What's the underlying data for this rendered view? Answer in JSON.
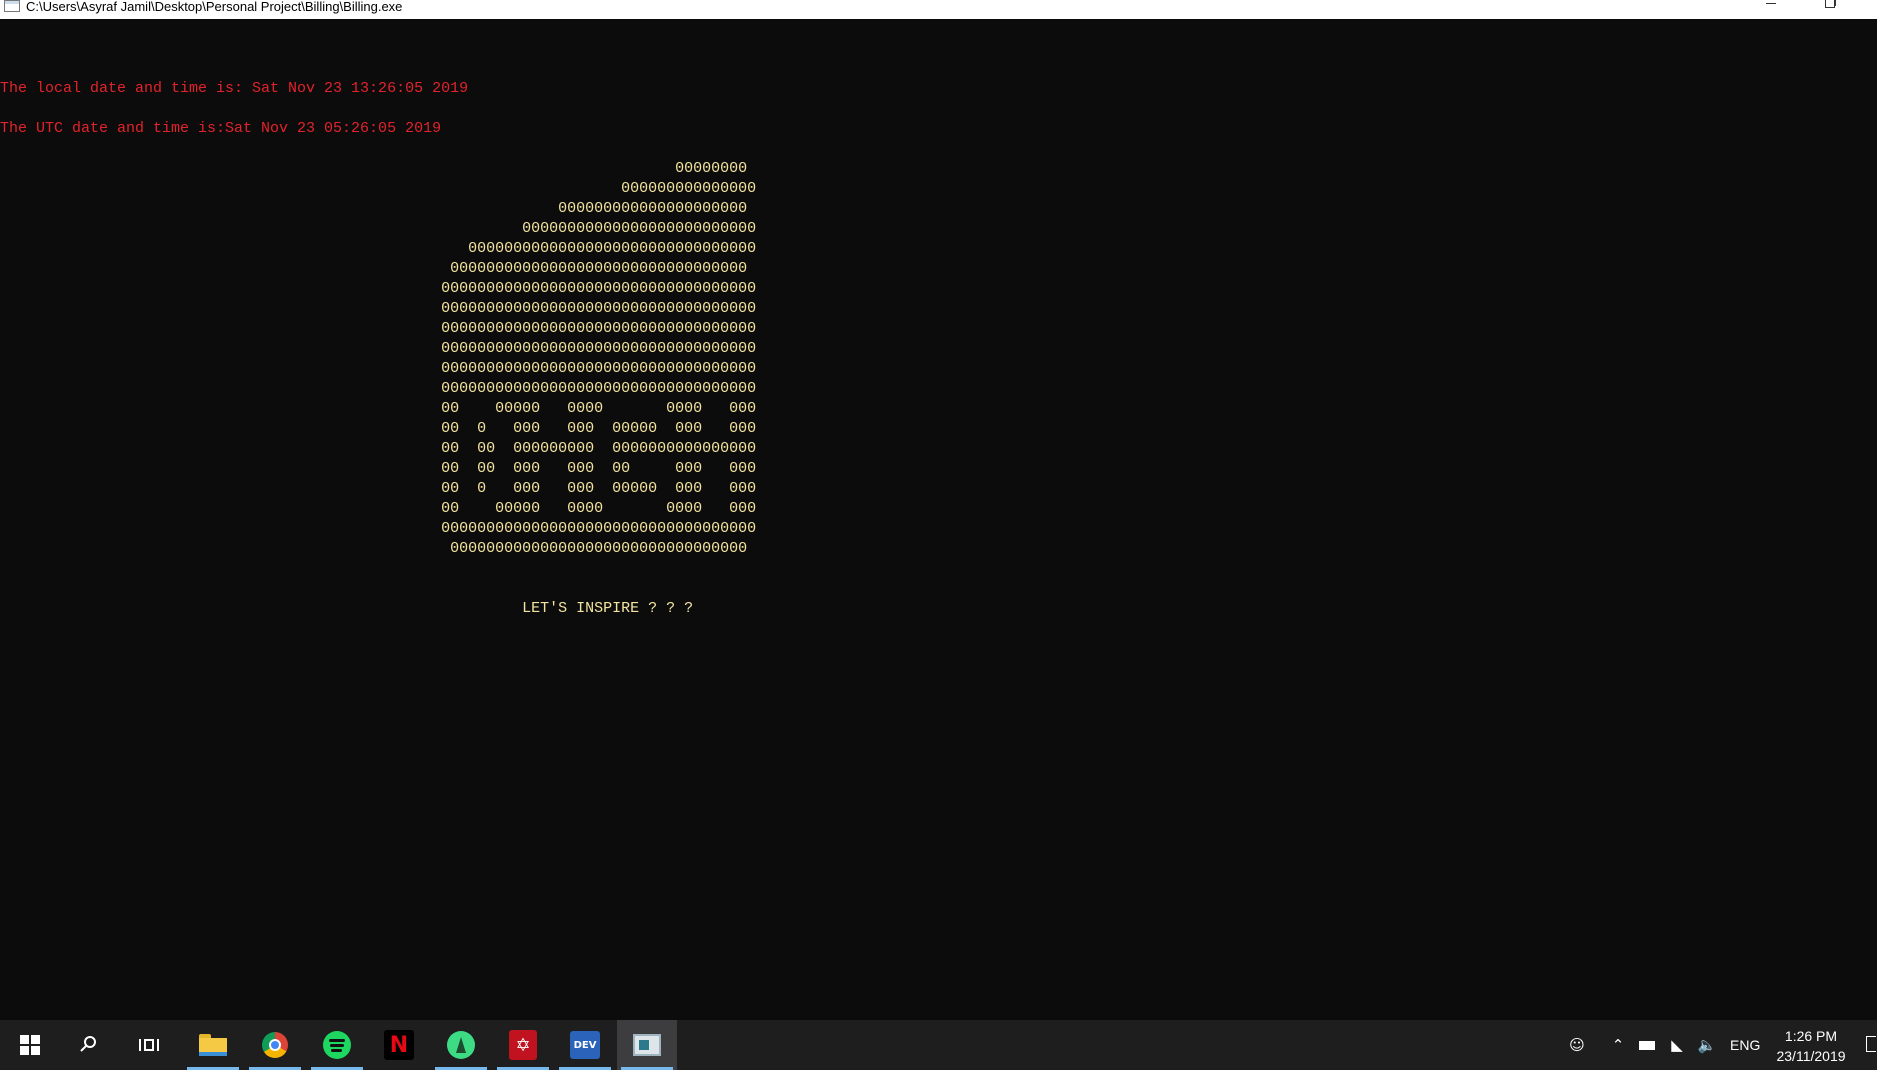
{
  "window": {
    "title": "C:\\Users\\Asyraf Jamil\\Desktop\\Personal Project\\Billing\\Billing.exe"
  },
  "console": {
    "local_time_line": "The local date and time is: Sat Nov 23 13:26:05 2019",
    "utc_time_line": "The UTC date and time is:Sat Nov 23 05:26:05 2019",
    "ascii_art": [
      "                                                                           00000000",
      "                                                                     000000000000000",
      "                                                              000000000000000000000",
      "                                                          00000000000000000000000000",
      "                                                    00000000000000000000000000000000",
      "                                                  000000000000000000000000000000000",
      "                                                 00000000000000000000000000000000000",
      "                                                 00000000000000000000000000000000000",
      "                                                 00000000000000000000000000000000000",
      "                                                 00000000000000000000000000000000000",
      "                                                 00000000000000000000000000000000000",
      "                                                 00000000000000000000000000000000000",
      "                                                 00    00000   0000       0000   000",
      "                                                 00  0   000   000  00000  000   000",
      "                                                 00  00  000000000  0000000000000000",
      "                                                 00  00  000   000  00     000   000",
      "                                                 00  0   000   000  00000  000   000",
      "                                                 00    00000   0000       0000   000",
      "                                                 00000000000000000000000000000000000",
      "                                                  000000000000000000000000000000000"
    ],
    "tagline": "                                                          LET'S INSPIRE ? ? ?",
    "colors": {
      "background": "#0c0c0c",
      "status_text": "#e3232b",
      "art_text": "#f4e4a0"
    }
  },
  "taskbar": {
    "apps": [
      {
        "name": "file-explorer-icon"
      },
      {
        "name": "chrome-icon"
      },
      {
        "name": "spotify-icon"
      },
      {
        "name": "netflix-icon",
        "glyph": "N"
      },
      {
        "name": "android-studio-icon"
      },
      {
        "name": "adobe-acrobat-icon"
      },
      {
        "name": "dev-cpp-icon",
        "glyph": "DEV"
      },
      {
        "name": "console-window-icon"
      }
    ],
    "tray": {
      "language": "ENG",
      "time": "1:26 PM",
      "date": "23/11/2019"
    },
    "accent": "#76b9ed"
  }
}
